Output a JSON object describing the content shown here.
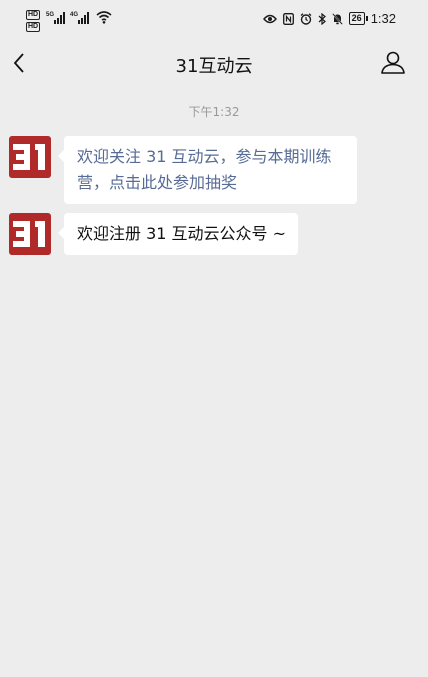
{
  "status_bar": {
    "hd_label": "HD",
    "network_1": "5G",
    "network_2": "4G",
    "battery": "26",
    "time": "1:32"
  },
  "nav": {
    "title": "31互动云",
    "back_icon": "chevron-left-icon",
    "profile_icon": "person-icon"
  },
  "chat": {
    "timestamp": "下午1:32",
    "messages": [
      {
        "sender_avatar": "31-logo",
        "text": "欢迎关注 31 互动云，参与本期训练营，点击此处参加抽奖",
        "is_link": true
      },
      {
        "sender_avatar": "31-logo",
        "text": "欢迎注册 31 互动云公众号 ~",
        "is_link": false
      }
    ]
  },
  "colors": {
    "background": "#ededed",
    "link": "#576b95",
    "avatar_red": "#b12a2a"
  }
}
